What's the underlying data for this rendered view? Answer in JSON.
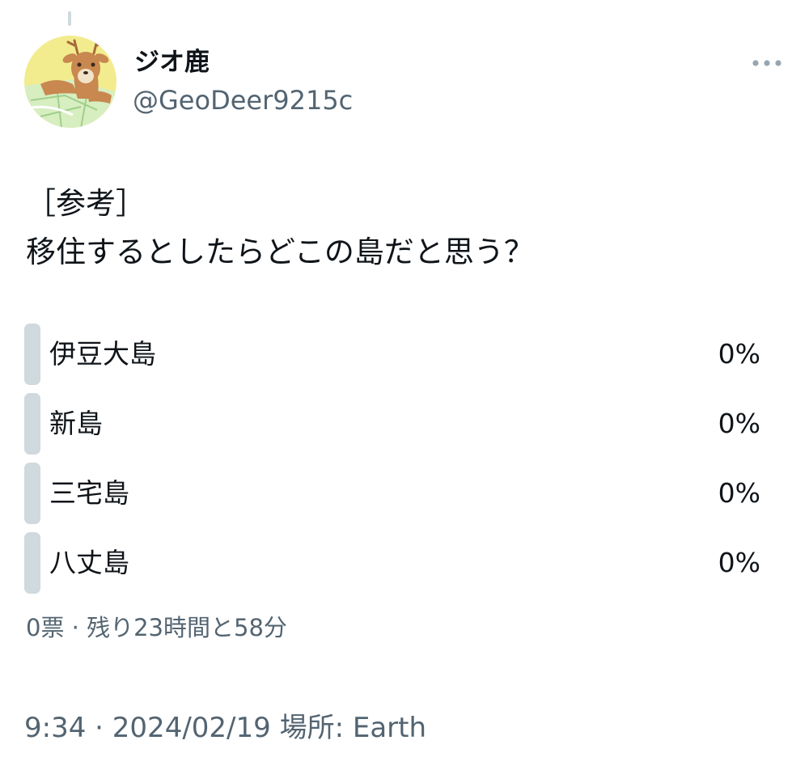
{
  "author": {
    "display_name": "ジオ鹿",
    "handle": "@GeoDeer9215c",
    "avatar_icon": "deer-with-map-avatar"
  },
  "more_icon": "more-horizontal-icon",
  "tweet": {
    "lines": [
      "［参考］",
      "移住するとしたらどこの島だと思う？"
    ]
  },
  "poll": {
    "options": [
      {
        "label": "伊豆大島",
        "percent": "0%"
      },
      {
        "label": "新島",
        "percent": "0%"
      },
      {
        "label": "三宅島",
        "percent": "0%"
      },
      {
        "label": "八丈島",
        "percent": "0%"
      }
    ],
    "meta": "0票 · 残り23時間と58分"
  },
  "footer": {
    "time": "9:34",
    "separator": " · ",
    "date": "2024/02/19",
    "location": "場所: Earth"
  },
  "colors": {
    "text_primary": "#0f1419",
    "text_secondary": "#536471",
    "poll_bar": "#cfd9de",
    "thread_line": "#cfd9de"
  }
}
